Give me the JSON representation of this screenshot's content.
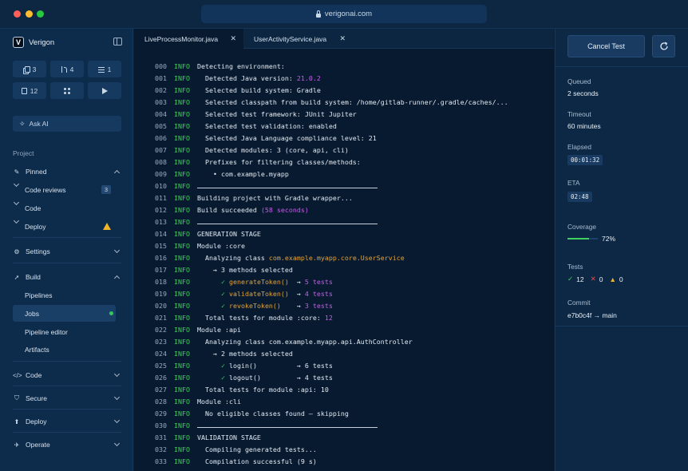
{
  "browser": {
    "url": "verigonai.com"
  },
  "sidebar": {
    "brand": "Verigon",
    "quick": [
      {
        "icon": "copy-icon",
        "count": "3"
      },
      {
        "icon": "merge-request-icon",
        "count": "4"
      },
      {
        "icon": "checklist-icon",
        "count": "1"
      },
      {
        "icon": "document-icon",
        "count": "12"
      },
      {
        "icon": "apps-grid-icon",
        "count": ""
      },
      {
        "icon": "play-icon",
        "count": ""
      }
    ],
    "ask_ai": "Ask AI",
    "section_label": "Project",
    "pinned": "Pinned",
    "pinned_items": [
      {
        "label": "Code reviews",
        "badge": "3"
      },
      {
        "label": "Code"
      },
      {
        "label": "Deploy"
      }
    ],
    "settings": "Settings",
    "build": "Build",
    "build_items": [
      "Pipelines",
      "Jobs",
      "Pipeline editor",
      "Artifacts"
    ],
    "groups": [
      "Code",
      "Secure",
      "Deploy",
      "Operate"
    ]
  },
  "tabs": [
    {
      "label": "LiveProcessMonitor.java"
    },
    {
      "label": "UserActivityService.java"
    }
  ],
  "console": [
    {
      "n": "000",
      "level": "INFO",
      "segs": [
        {
          "t": "Detecting environment:"
        }
      ]
    },
    {
      "n": "001",
      "level": "INFO",
      "segs": [
        {
          "t": "  Detected Java version: "
        },
        {
          "t": "21.0.2",
          "c": "p"
        }
      ]
    },
    {
      "n": "002",
      "level": "INFO",
      "segs": [
        {
          "t": "  Selected build system: Gradle"
        }
      ]
    },
    {
      "n": "003",
      "level": "INFO",
      "segs": [
        {
          "t": "  Selected classpath from build system: /home/gitlab-runner/.gradle/caches/..."
        }
      ]
    },
    {
      "n": "004",
      "level": "INFO",
      "segs": [
        {
          "t": "  Selected test framework: JUnit Jupiter"
        }
      ]
    },
    {
      "n": "005",
      "level": "INFO",
      "segs": [
        {
          "t": "  Selected test validation: enabled"
        }
      ]
    },
    {
      "n": "006",
      "level": "INFO",
      "segs": [
        {
          "t": "  Selected Java Language compliance level: 21"
        }
      ]
    },
    {
      "n": "007",
      "level": "INFO",
      "segs": [
        {
          "t": "  Detected modules: 3 (core, api, cli)"
        }
      ]
    },
    {
      "n": "008",
      "level": "INFO",
      "segs": [
        {
          "t": "  Prefixes for filtering classes/methods:"
        }
      ]
    },
    {
      "n": "009",
      "level": "INFO",
      "segs": [
        {
          "t": "    • com.example.myapp"
        }
      ]
    },
    {
      "n": "010",
      "level": "INFO",
      "sep": true,
      "segs": []
    },
    {
      "n": "011",
      "level": "INFO",
      "segs": [
        {
          "t": "Building project with Gradle wrapper..."
        }
      ]
    },
    {
      "n": "012",
      "level": "INFO",
      "segs": [
        {
          "t": "Build succeeded "
        },
        {
          "t": "(58 seconds)",
          "c": "p"
        }
      ]
    },
    {
      "n": "013",
      "level": "INFO",
      "sep": true,
      "segs": []
    },
    {
      "n": "014",
      "level": "INFO",
      "segs": [
        {
          "t": "GENERATION STAGE"
        }
      ]
    },
    {
      "n": "015",
      "level": "INFO",
      "segs": [
        {
          "t": "Module :core"
        }
      ]
    },
    {
      "n": "016",
      "level": "INFO",
      "segs": [
        {
          "t": "  Analyzing class "
        },
        {
          "t": "com.example.myapp.core.UserService",
          "c": "o"
        }
      ]
    },
    {
      "n": "017",
      "level": "INFO",
      "segs": [
        {
          "t": "    → 3 methods selected"
        }
      ]
    },
    {
      "n": "018",
      "level": "INFO",
      "segs": [
        {
          "t": "      "
        },
        {
          "t": "✓",
          "c": "ck"
        },
        {
          "t": " "
        },
        {
          "t": "generateToken()",
          "c": "oc"
        },
        {
          "t": "  → "
        },
        {
          "t": "5 tests",
          "c": "p"
        }
      ]
    },
    {
      "n": "019",
      "level": "INFO",
      "segs": [
        {
          "t": "      "
        },
        {
          "t": "✓",
          "c": "ck"
        },
        {
          "t": " "
        },
        {
          "t": "validateToken()",
          "c": "oc"
        },
        {
          "t": "  → "
        },
        {
          "t": "4 tests",
          "c": "p"
        }
      ]
    },
    {
      "n": "020",
      "level": "INFO",
      "segs": [
        {
          "t": "      "
        },
        {
          "t": "✓",
          "c": "ck"
        },
        {
          "t": " "
        },
        {
          "t": "revokeToken()",
          "c": "oc"
        },
        {
          "t": "    → "
        },
        {
          "t": "3 tests",
          "c": "p"
        }
      ]
    },
    {
      "n": "021",
      "level": "INFO",
      "segs": [
        {
          "t": "  Total tests for module :core: "
        },
        {
          "t": "12",
          "c": "p"
        }
      ]
    },
    {
      "n": "022",
      "level": "INFO",
      "segs": [
        {
          "t": "Module :api"
        }
      ]
    },
    {
      "n": "023",
      "level": "INFO",
      "segs": [
        {
          "t": "  Analyzing class com.example.myapp.api.AuthController"
        }
      ]
    },
    {
      "n": "024",
      "level": "INFO",
      "segs": [
        {
          "t": "    → 2 methods selected"
        }
      ]
    },
    {
      "n": "025",
      "level": "INFO",
      "segs": [
        {
          "t": "      "
        },
        {
          "t": "✓",
          "c": "ck"
        },
        {
          "t": " login()          → 6 tests"
        }
      ]
    },
    {
      "n": "026",
      "level": "INFO",
      "segs": [
        {
          "t": "      "
        },
        {
          "t": "✓",
          "c": "ck"
        },
        {
          "t": " logout()         → 4 tests"
        }
      ]
    },
    {
      "n": "027",
      "level": "INFO",
      "segs": [
        {
          "t": "  Total tests for module :api: 10"
        }
      ]
    },
    {
      "n": "028",
      "level": "INFO",
      "segs": [
        {
          "t": "Module :cli"
        }
      ]
    },
    {
      "n": "029",
      "level": "INFO",
      "segs": [
        {
          "t": "  No eligible classes found — skipping"
        }
      ]
    },
    {
      "n": "030",
      "level": "INFO",
      "sep": true,
      "segs": []
    },
    {
      "n": "031",
      "level": "INFO",
      "segs": [
        {
          "t": "VALIDATION STAGE"
        }
      ]
    },
    {
      "n": "032",
      "level": "INFO",
      "segs": [
        {
          "t": "  Compiling generated tests..."
        }
      ]
    },
    {
      "n": "033",
      "level": "INFO",
      "segs": [
        {
          "t": "  Compilation successful (9 s)"
        }
      ]
    }
  ],
  "panel": {
    "cancel_label": "Cancel Test",
    "queued_label": "Queued",
    "queued_value": "2 seconds",
    "timeout_label": "Timeout",
    "timeout_value": "60 minutes",
    "elapsed_label": "Elapsed",
    "elapsed_value": "00:01:32",
    "eta_label": "ETA",
    "eta_value": "02:48",
    "coverage_label": "Coverage",
    "coverage_value": "72%",
    "coverage_fraction": 0.72,
    "tests_label": "Tests",
    "tests_passed": "12",
    "tests_failed": "0",
    "tests_warn": "0",
    "commit_label": "Commit",
    "commit_value": "e7b0c4f → main"
  },
  "colors": {
    "success": "#3fcf5c",
    "purple": "#c85de8",
    "orange": "#e3a33a",
    "warning": "#f0b429",
    "error": "#e5484d",
    "background": "#0b2038"
  }
}
